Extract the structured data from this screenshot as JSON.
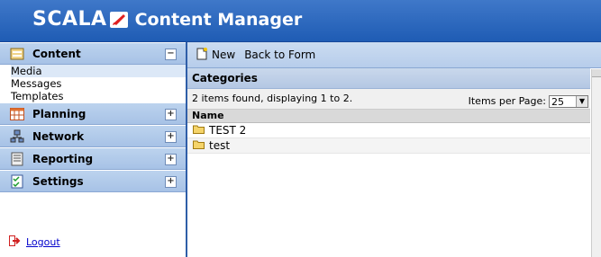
{
  "brand": {
    "name": "SCALA",
    "product": "Content Manager"
  },
  "sidebar": {
    "sections": [
      {
        "label": "Content",
        "toggle": "−",
        "icon": "content-icon"
      },
      {
        "label": "Planning",
        "toggle": "+",
        "icon": "planning-icon"
      },
      {
        "label": "Network",
        "toggle": "+",
        "icon": "network-icon"
      },
      {
        "label": "Reporting",
        "toggle": "+",
        "icon": "reporting-icon"
      },
      {
        "label": "Settings",
        "toggle": "+",
        "icon": "settings-icon"
      }
    ],
    "content_items": [
      "Media",
      "Messages",
      "Templates"
    ],
    "logout": "Logout"
  },
  "toolbar": {
    "new_label": "New",
    "back_label": "Back to Form"
  },
  "panel": {
    "title": "Categories",
    "summary": "2 items found, displaying 1 to 2.",
    "items_per_page_label": "Items per Page:",
    "items_per_page_value": "25",
    "column_name": "Name",
    "rows": [
      "TEST 2",
      "test"
    ]
  }
}
